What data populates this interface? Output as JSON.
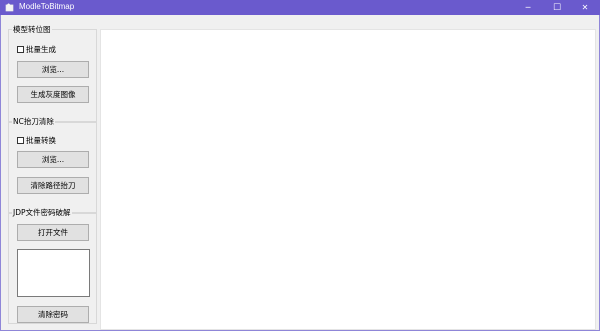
{
  "window": {
    "title": "ModleToBitmap",
    "minimize_glyph": "─",
    "maximize_glyph": "☐",
    "close_glyph": "✕"
  },
  "model_to_bitmap": {
    "title": "模型转位图",
    "batch_checkbox_label": "批量生成",
    "batch_checked": false,
    "browse_button": "浏览...",
    "generate_button": "生成灰度图像"
  },
  "nc_lift_remove": {
    "title": "NC抬刀清除",
    "batch_checkbox_label": "批量转换",
    "batch_checked": false,
    "browse_button": "浏览...",
    "clear_button": "清除路径抬刀"
  },
  "jdp_crack": {
    "title": "JDP文件密码破解",
    "open_button": "打开文件",
    "textarea_value": "",
    "clear_button": "清除密码"
  },
  "colors": {
    "titlebar": "#6a5acd",
    "window_bg": "#f0f0f0",
    "canvas_bg": "#ffffff"
  }
}
